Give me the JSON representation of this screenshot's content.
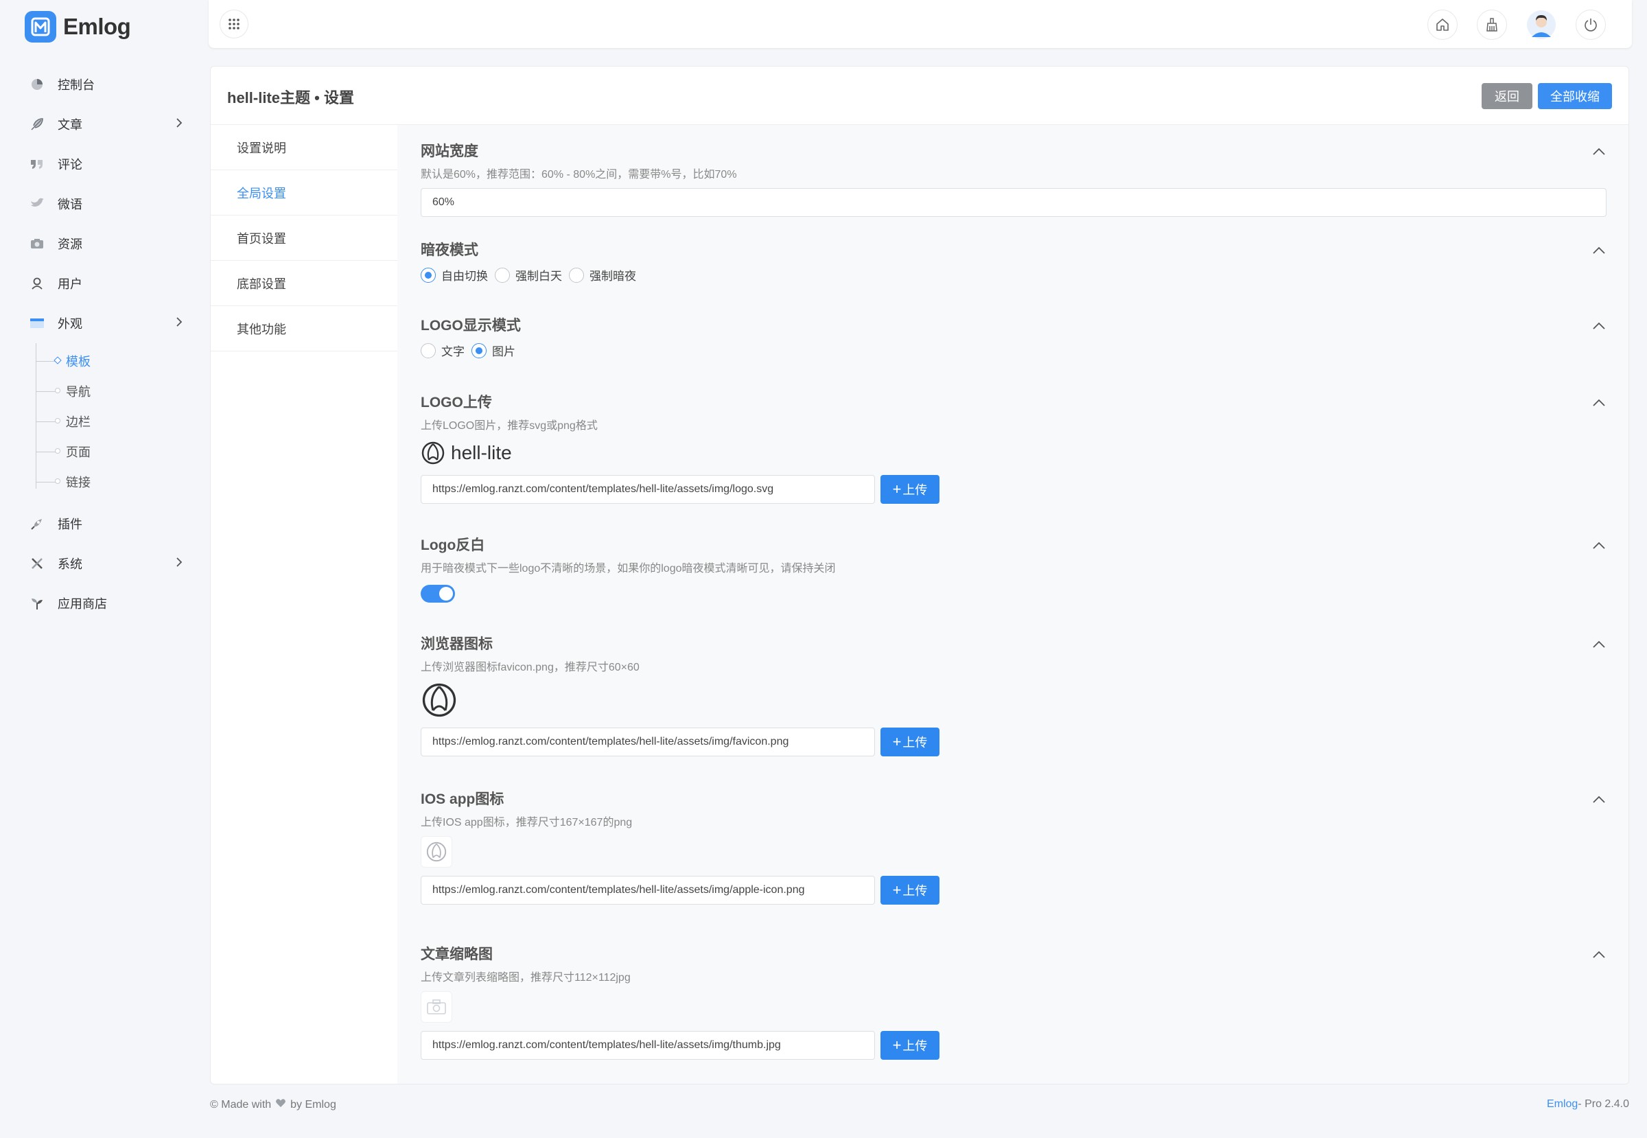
{
  "brand": {
    "name": "Emlog"
  },
  "sidebar": {
    "items": [
      {
        "label": "控制台"
      },
      {
        "label": "文章"
      },
      {
        "label": "评论"
      },
      {
        "label": "微语"
      },
      {
        "label": "资源"
      },
      {
        "label": "用户"
      },
      {
        "label": "外观"
      },
      {
        "label": "插件"
      },
      {
        "label": "系统"
      },
      {
        "label": "应用商店"
      }
    ],
    "appearance_sub": [
      {
        "label": "模板"
      },
      {
        "label": "导航"
      },
      {
        "label": "边栏"
      },
      {
        "label": "页面"
      },
      {
        "label": "链接"
      }
    ]
  },
  "panel": {
    "title": "hell-lite主题 • 设置",
    "back_label": "返回",
    "collapse_label": "全部收缩"
  },
  "tabs": [
    {
      "label": "设置说明"
    },
    {
      "label": "全局设置"
    },
    {
      "label": "首页设置"
    },
    {
      "label": "底部设置"
    },
    {
      "label": "其他功能"
    }
  ],
  "settings": {
    "width": {
      "title": "网站宽度",
      "desc": "默认是60%，推荐范围：60% - 80%之间，需要带%号，比如70%",
      "value": "60%"
    },
    "dark": {
      "title": "暗夜模式",
      "options": [
        "自由切换",
        "强制白天",
        "强制暗夜"
      ],
      "selected": "自由切换"
    },
    "logo_mode": {
      "title": "LOGO显示模式",
      "options": [
        "文字",
        "图片"
      ],
      "selected": "图片"
    },
    "logo_upload": {
      "title": "LOGO上传",
      "desc": "上传LOGO图片，推荐svg或png格式",
      "preview_text": "hell-lite",
      "url": "https://emlog.ranzt.com/content/templates/hell-lite/assets/img/logo.svg"
    },
    "logo_invert": {
      "title": "Logo反白",
      "desc": "用于暗夜模式下一些logo不清晰的场景，如果你的logo暗夜模式清晰可见，请保持关闭",
      "enabled": true
    },
    "favicon": {
      "title": "浏览器图标",
      "desc": "上传浏览器图标favicon.png，推荐尺寸60×60",
      "url": "https://emlog.ranzt.com/content/templates/hell-lite/assets/img/favicon.png"
    },
    "ios_icon": {
      "title": "IOS app图标",
      "desc": "上传IOS app图标，推荐尺寸167×167的png",
      "url": "https://emlog.ranzt.com/content/templates/hell-lite/assets/img/apple-icon.png"
    },
    "thumb": {
      "title": "文章缩略图",
      "desc": "上传文章列表缩略图，推荐尺寸112×112jpg",
      "url": "https://emlog.ranzt.com/content/templates/hell-lite/assets/img/thumb.jpg"
    },
    "upload_label": "上传"
  },
  "footer": {
    "made_with": "© Made with",
    "by": "by Emlog",
    "version_brand": "Emlog",
    "version_text": "- Pro 2.4.0"
  },
  "colors": {
    "accent": "#3b8ff3",
    "back_button": "#8f9296"
  }
}
